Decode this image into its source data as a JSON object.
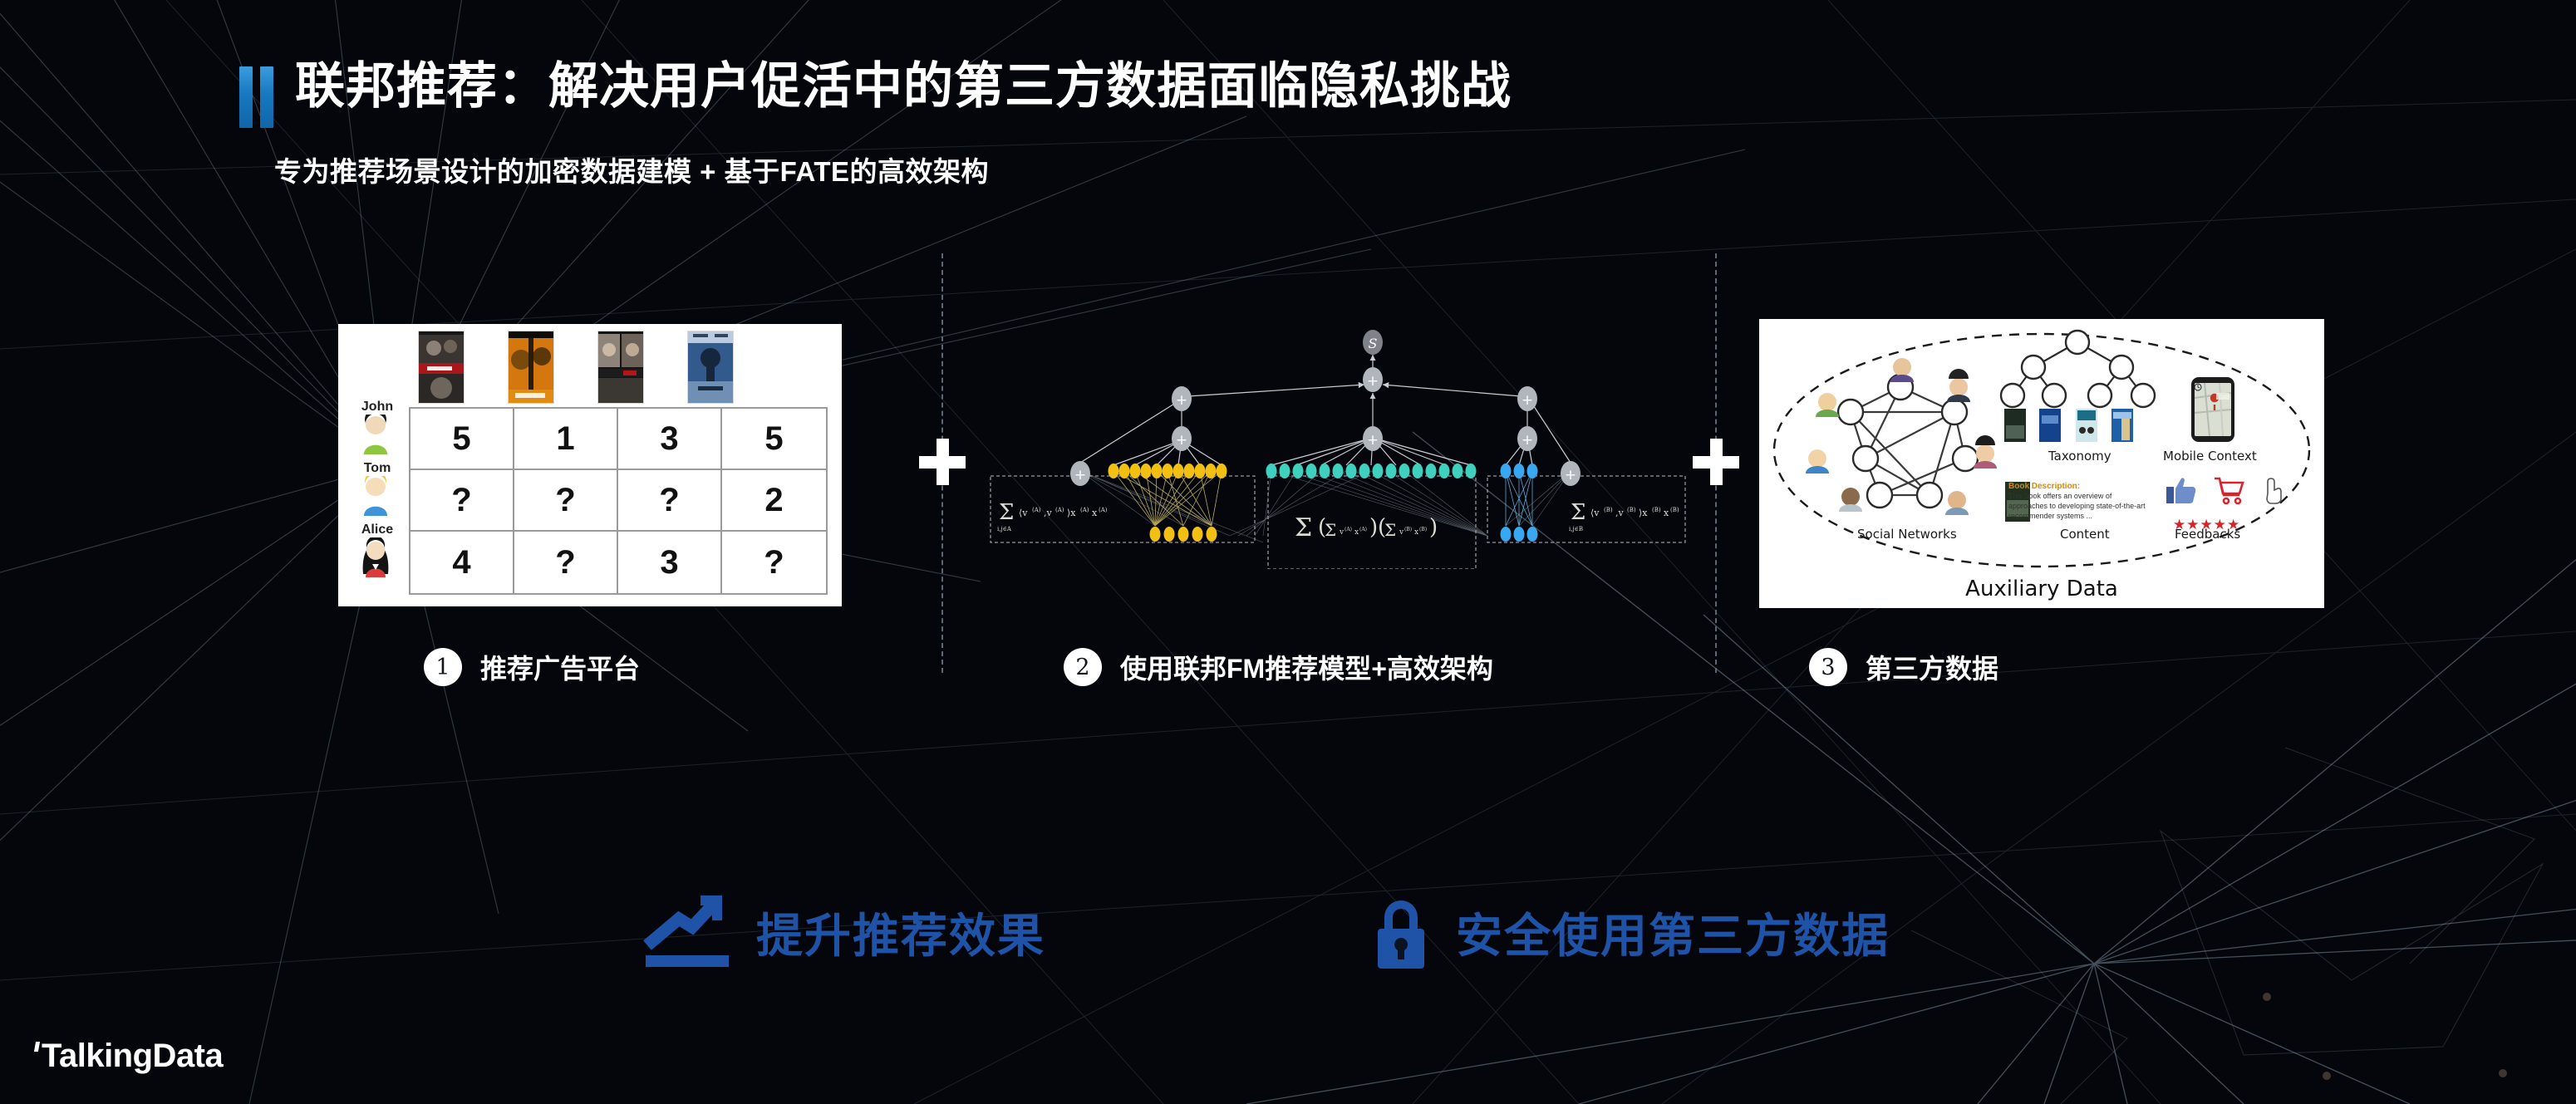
{
  "slide": {
    "title": "联邦推荐：解决用户促活中的第三方数据面临隐私挑战",
    "subtitle": "专为推荐场景设计的加密数据建模 + 基于FATE的高效架构",
    "accent_color": "#1878c0",
    "background_color": "#04060c"
  },
  "steps": [
    {
      "number": "1",
      "label": "推荐广告平台"
    },
    {
      "number": "2",
      "label": "使用联邦FM推荐模型+高效架构"
    },
    {
      "number": "3",
      "label": "第三方数据"
    }
  ],
  "separators": {
    "plus": "+"
  },
  "panel1": {
    "name": "推荐广告平台",
    "users": [
      "John",
      "Tom",
      "Alice"
    ],
    "movie_count": 4,
    "ratings": [
      [
        "5",
        "1",
        "3",
        "5"
      ],
      [
        "?",
        "?",
        "?",
        "2"
      ],
      [
        "4",
        "?",
        "3",
        "?"
      ]
    ]
  },
  "panel2": {
    "name": "联邦FM推荐模型",
    "output_node": "S",
    "operator_node": "+",
    "groups": [
      {
        "party": "A",
        "color": "#f2c013",
        "units": 11
      },
      {
        "party": "shared",
        "color": "#3fd0bf",
        "units": 16
      },
      {
        "party": "B",
        "color": "#38a8f0",
        "units": 3
      }
    ],
    "formulas": [
      "∑ ⟨v(A), v(A)⟩ x(A) x(A)",
      "∑ ( ∑ v(A) x(A) ) ( ∑ v(B) x(B) )",
      "∑ ⟨v(B), v(B)⟩ x(B) x(B)"
    ]
  },
  "panel3": {
    "name": "第三方数据",
    "title": "Auxiliary Data",
    "labels": [
      "Social Networks",
      "Taxonomy",
      "Mobile Context",
      "Content",
      "Feedbacks"
    ],
    "book_description_head": "Book Description:",
    "book_description_body": "This book offers an overview of approaches to developing state-of-the-art recommender systems ...",
    "stars": "★★★★★"
  },
  "benefits": [
    {
      "icon": "trend-up-icon",
      "label": "提升推荐效果"
    },
    {
      "icon": "lock-icon",
      "label": "安全使用第三方数据"
    }
  ],
  "logo": {
    "text": "TalkingData"
  }
}
